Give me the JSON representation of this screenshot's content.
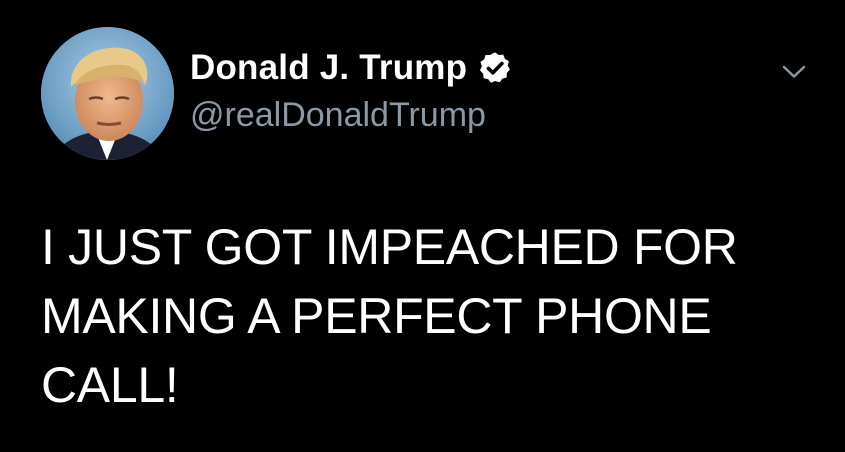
{
  "tweet": {
    "display_name": "Donald J. Trump",
    "handle": "@realDonaldTrump",
    "text": "I JUST GOT IMPEACHED FOR MAKING A PERFECT PHONE CALL!",
    "verified": true,
    "icons": {
      "avatar": "profile-avatar",
      "verified": "verified-badge-icon",
      "menu": "chevron-down-icon"
    }
  },
  "colors": {
    "background": "#000000",
    "primary_text": "#ffffff",
    "secondary_text": "#8b98a5"
  }
}
